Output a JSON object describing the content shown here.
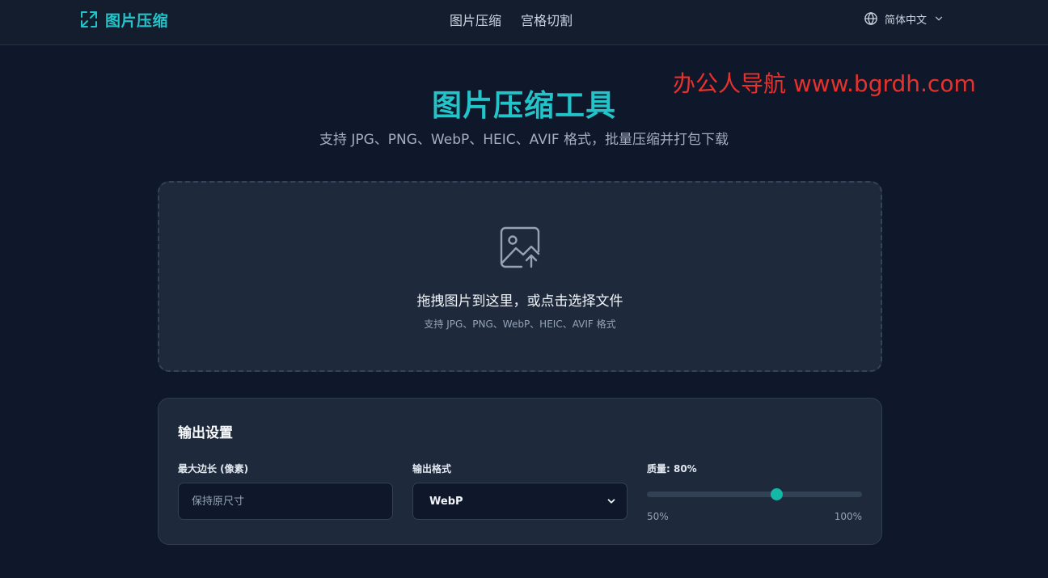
{
  "header": {
    "brand": "图片压缩",
    "nav": [
      "图片压缩",
      "宫格切割"
    ],
    "language": "简体中文",
    "icons": {
      "brand": "compress-icon",
      "language": "globe-icon",
      "dropdown": "chevron-down-icon"
    }
  },
  "watermark": "办公人导航 www.bgrdh.com",
  "hero": {
    "title": "图片压缩工具",
    "subtitle": "支持 JPG、PNG、WebP、HEIC、AVIF 格式，批量压缩并打包下载"
  },
  "upload": {
    "icon": "image-upload-icon",
    "title": "拖拽图片到这里，或点击选择文件",
    "subtitle": "支持 JPG、PNG、WebP、HEIC、AVIF 格式"
  },
  "settings": {
    "title": "输出设置",
    "max_edge": {
      "label": "最大边长 (像素)",
      "value": "",
      "placeholder": "保持原尺寸"
    },
    "format": {
      "label": "输出格式",
      "selected": "WebP"
    },
    "quality": {
      "label": "质量: 80%",
      "value": 80,
      "min": 50,
      "max": 100,
      "min_label": "50%",
      "max_label": "100%"
    }
  },
  "colors": {
    "accent": "#22c3c9",
    "slider_thumb": "#14b8a6",
    "background": "#0f172a",
    "card": "#1e293b",
    "watermark": "#e5322d"
  }
}
